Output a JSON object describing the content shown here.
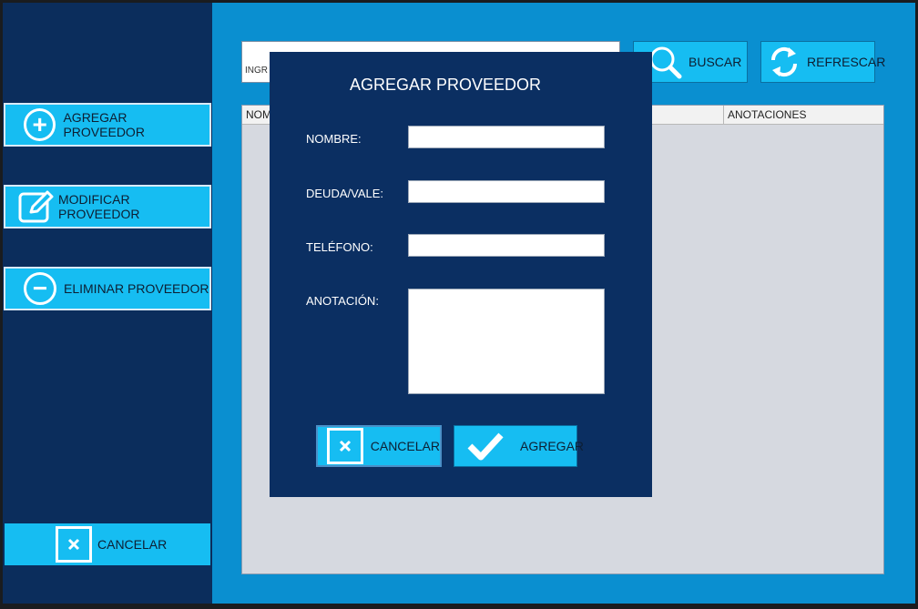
{
  "sidebar": {
    "add_label": "AGREGAR PROVEEDOR",
    "edit_label": "MODIFICAR PROVEEDOR",
    "delete_label": "ELIMINAR PROVEEDOR",
    "cancel_label": "CANCELAR"
  },
  "toolbar": {
    "search_value": "INGR",
    "search_label": "BUSCAR",
    "refresh_label": "REFRESCAR"
  },
  "table": {
    "columns": [
      "NOM",
      "ANOTACIONES"
    ]
  },
  "dialog": {
    "title": "AGREGAR PROVEEDOR",
    "fields": {
      "nombre_label": "NOMBRE:",
      "deuda_label": "DEUDA/VALE:",
      "telefono_label": "TELÉFONO:",
      "anotacion_label": "ANOTACIÓN:"
    },
    "cancel_label": "CANCELAR",
    "add_label": "AGREGAR"
  },
  "colors": {
    "sidebar_bg": "#0b2d5c",
    "main_bg": "#0a8fd0",
    "button_bg": "#16bdf2",
    "dialog_bg": "#0b2f62"
  },
  "icons": [
    "plus-circle-icon",
    "edit-icon",
    "minus-circle-icon",
    "close-box-icon",
    "search-icon",
    "refresh-icon",
    "check-icon"
  ]
}
